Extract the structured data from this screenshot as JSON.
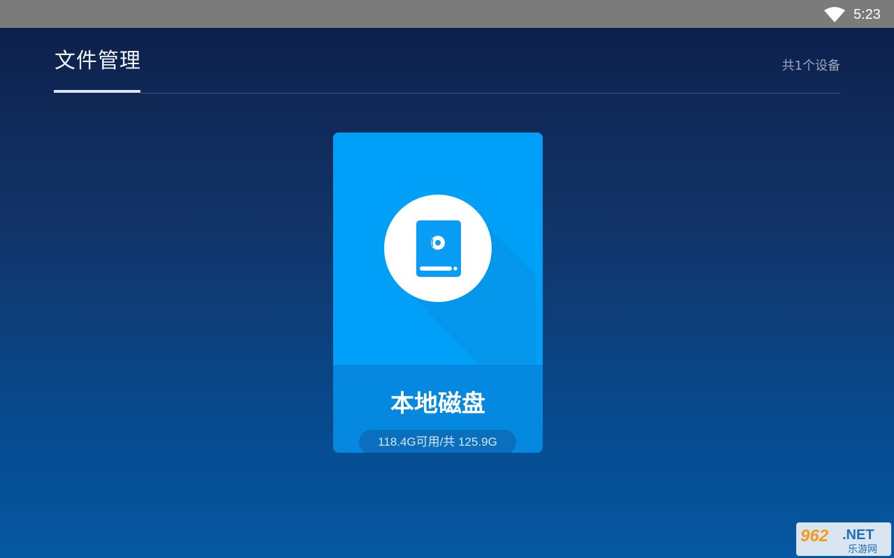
{
  "status_bar": {
    "time": "5:23",
    "wifi_icon": "wifi-icon"
  },
  "header": {
    "title": "文件管理",
    "device_count": "共1个设备"
  },
  "devices": [
    {
      "name": "本地磁盘",
      "storage": "118.4G可用/共 125.9G",
      "icon": "hard-drive-icon",
      "available_gb": 118.4,
      "total_gb": 125.9
    }
  ],
  "watermark": {
    "number": "962",
    "suffix": ".NET",
    "tagline": "乐游网"
  },
  "colors": {
    "card_top": "#009ff8",
    "card_bottom": "#0589e0",
    "storage_pill": "#0a6fbd",
    "status_bar": "#7b7b7b"
  }
}
